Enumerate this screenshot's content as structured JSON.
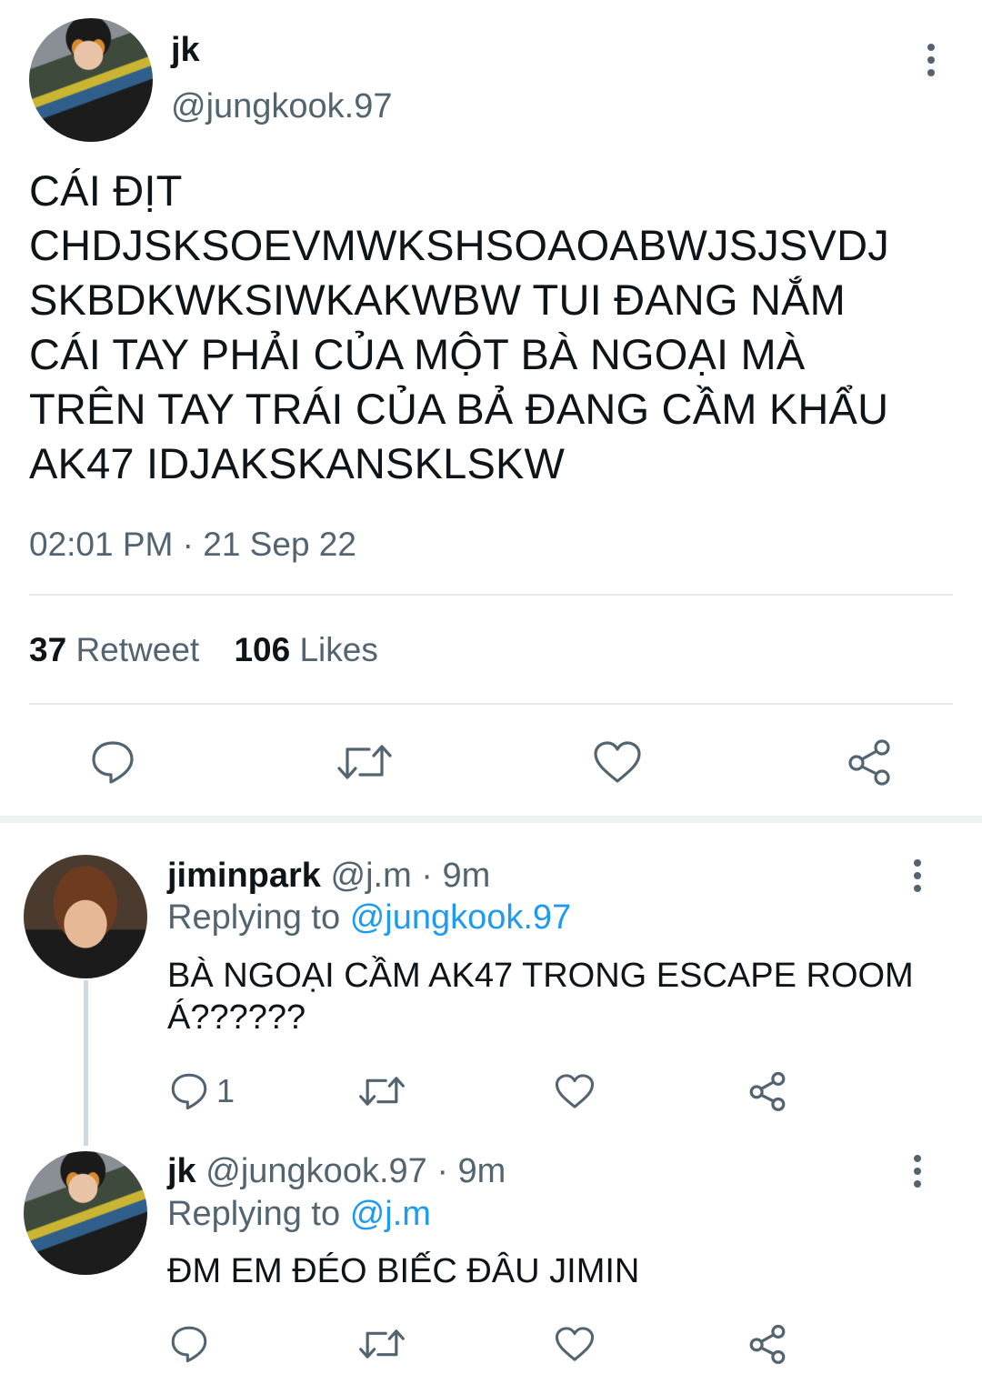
{
  "main_tweet": {
    "display_name": "jk",
    "handle": "@jungkook.97",
    "text_lines": [
      "CÁI ĐỊT",
      "CHDJSKSOEVMWKSHSOAOABWJSJSVDJ",
      "SKBDKWKSIWKAKWBW TUI ĐANG NẮM",
      "CÁI TAY PHẢI CỦA MỘT BÀ NGOẠI MÀ",
      "TRÊN TAY TRÁI CỦA BẢ ĐANG CẦM KHẨU",
      "AK47 IDJAKSKANSKLSKW"
    ],
    "timestamp": "02:01 PM · 21 Sep 22",
    "retweet_count": "37",
    "retweet_label": "Retweet",
    "like_count": "106",
    "like_label": "Likes"
  },
  "replies": [
    {
      "display_name": "jiminpark",
      "meta": "@j.m · 9m",
      "replying_prefix": "Replying to",
      "replying_to": "@jungkook.97",
      "text_lines": [
        "BÀ NGOẠI CẦM AK47 TRONG ESCAPE ROOM",
        "Á??????"
      ],
      "reply_count": "1"
    },
    {
      "display_name": "jk",
      "meta": "@jungkook.97 · 9m",
      "replying_prefix": "Replying to",
      "replying_to": "@j.m",
      "text_lines": [
        "ĐM EM ĐÉO BIẾC ĐÂU JIMIN"
      ],
      "reply_count": ""
    }
  ],
  "icons": {
    "reply": "speech-bubble-icon",
    "retweet": "retweet-arrows-icon",
    "like": "heart-icon",
    "share": "share-nodes-icon",
    "more": "vertical-dots-icon"
  },
  "colors": {
    "text": "#0f1419",
    "muted": "#536471",
    "link": "#1d9bf0",
    "divider": "#e7e9ea"
  }
}
